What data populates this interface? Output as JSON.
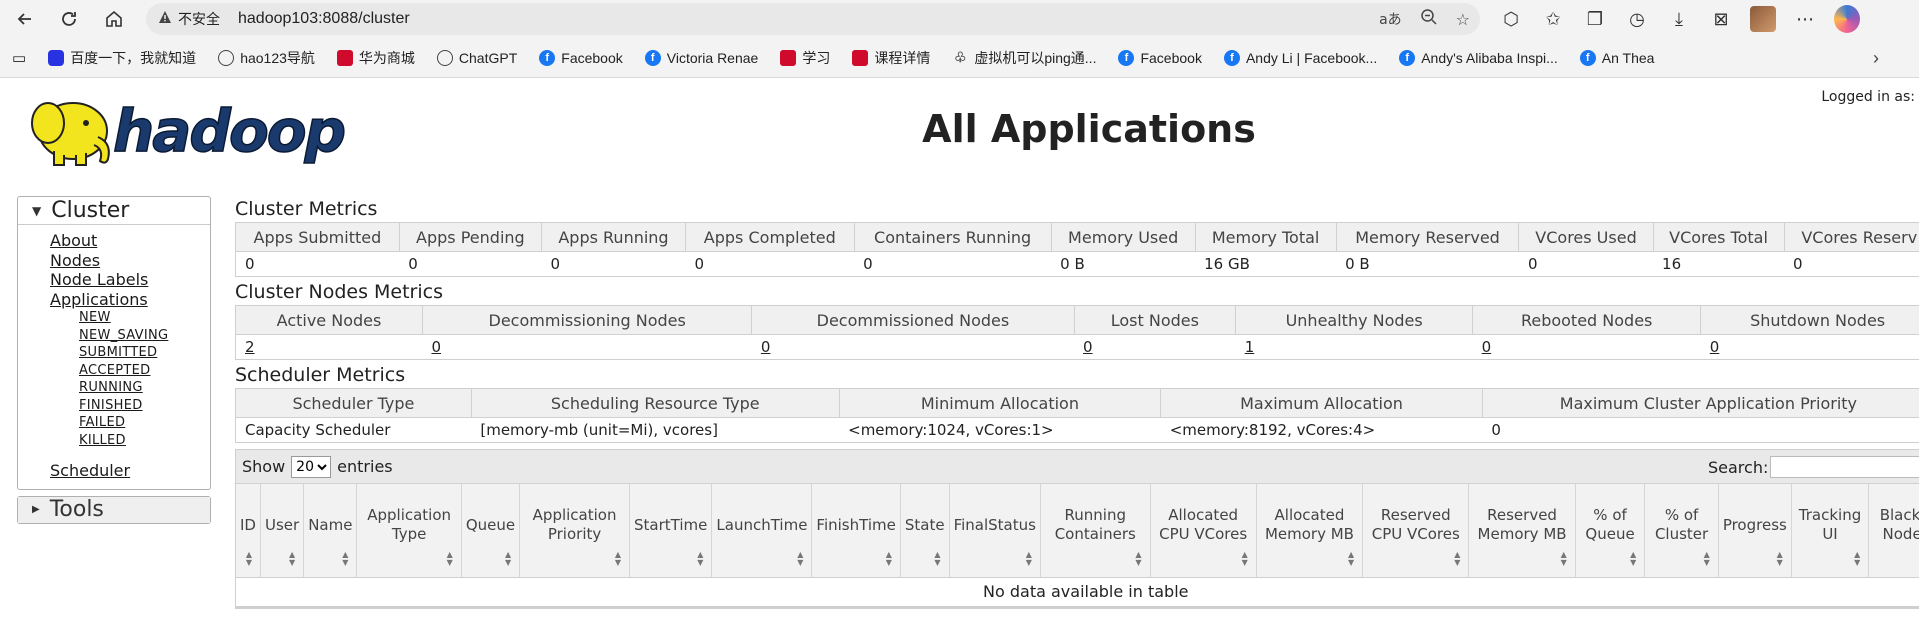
{
  "browser": {
    "insecure_label": "不安全",
    "url": "hadoop103:8088/cluster",
    "bookmarks": [
      {
        "label": "百度一下，我就知道",
        "icon": "baidu-icon"
      },
      {
        "label": "hao123导航",
        "icon": "globe-icon"
      },
      {
        "label": "华为商城",
        "icon": "huawei-icon"
      },
      {
        "label": "ChatGPT",
        "icon": "globe-icon"
      },
      {
        "label": "Facebook",
        "icon": "facebook-icon"
      },
      {
        "label": "Victoria Renae",
        "icon": "facebook-icon"
      },
      {
        "label": "学习",
        "icon": "huawei-icon"
      },
      {
        "label": "课程详情",
        "icon": "huawei-icon"
      },
      {
        "label": "虚拟机可以ping通...",
        "icon": "leaf-icon"
      },
      {
        "label": "Facebook",
        "icon": "facebook-icon"
      },
      {
        "label": "Andy Li | Facebook...",
        "icon": "facebook-icon"
      },
      {
        "label": "Andy's Alibaba Inspi...",
        "icon": "facebook-icon"
      },
      {
        "label": "An Thea",
        "icon": "facebook-icon"
      }
    ]
  },
  "page": {
    "title": "All Applications",
    "logo_text": "hadoop",
    "logged_in": "Logged in as:"
  },
  "sidebar": {
    "cluster_label": "Cluster",
    "links": [
      "About",
      "Nodes",
      "Node Labels",
      "Applications"
    ],
    "states": [
      "NEW",
      "NEW_SAVING",
      "SUBMITTED",
      "ACCEPTED",
      "RUNNING",
      "FINISHED",
      "FAILED",
      "KILLED"
    ],
    "scheduler": "Scheduler",
    "tools_label": "Tools"
  },
  "cluster_metrics": {
    "title": "Cluster Metrics",
    "headers": [
      "Apps Submitted",
      "Apps Pending",
      "Apps Running",
      "Apps Completed",
      "Containers Running",
      "Memory Used",
      "Memory Total",
      "Memory Reserved",
      "VCores Used",
      "VCores Total",
      "VCores Reserv"
    ],
    "values": [
      "0",
      "0",
      "0",
      "0",
      "0",
      "0 B",
      "16 GB",
      "0 B",
      "0",
      "16",
      "0"
    ]
  },
  "node_metrics": {
    "title": "Cluster Nodes Metrics",
    "headers": [
      "Active Nodes",
      "Decommissioning Nodes",
      "Decommissioned Nodes",
      "Lost Nodes",
      "Unhealthy Nodes",
      "Rebooted Nodes",
      "Shutdown Nodes"
    ],
    "values": [
      "2",
      "0",
      "0",
      "0",
      "1",
      "0",
      "0"
    ]
  },
  "scheduler_metrics": {
    "title": "Scheduler Metrics",
    "headers": [
      "Scheduler Type",
      "Scheduling Resource Type",
      "Minimum Allocation",
      "Maximum Allocation",
      "Maximum Cluster Application Priority"
    ],
    "values": [
      "Capacity Scheduler",
      "[memory-mb (unit=Mi), vcores]",
      "<memory:1024, vCores:1>",
      "<memory:8192, vCores:4>",
      "0"
    ]
  },
  "apps_table": {
    "show_label": "Show",
    "entries_label": "entries",
    "page_size": "20",
    "search_label": "Search:",
    "columns": [
      "ID",
      "User",
      "Name",
      "Application Type",
      "Queue",
      "Application Priority",
      "StartTime",
      "LaunchTime",
      "FinishTime",
      "State",
      "FinalStatus",
      "Running Containers",
      "Allocated CPU VCores",
      "Allocated Memory MB",
      "Reserved CPU VCores",
      "Reserved Memory MB",
      "% of Queue",
      "% of Cluster",
      "Progress",
      "Tracking UI",
      "Blackl Node"
    ],
    "empty_text": "No data available in table"
  }
}
